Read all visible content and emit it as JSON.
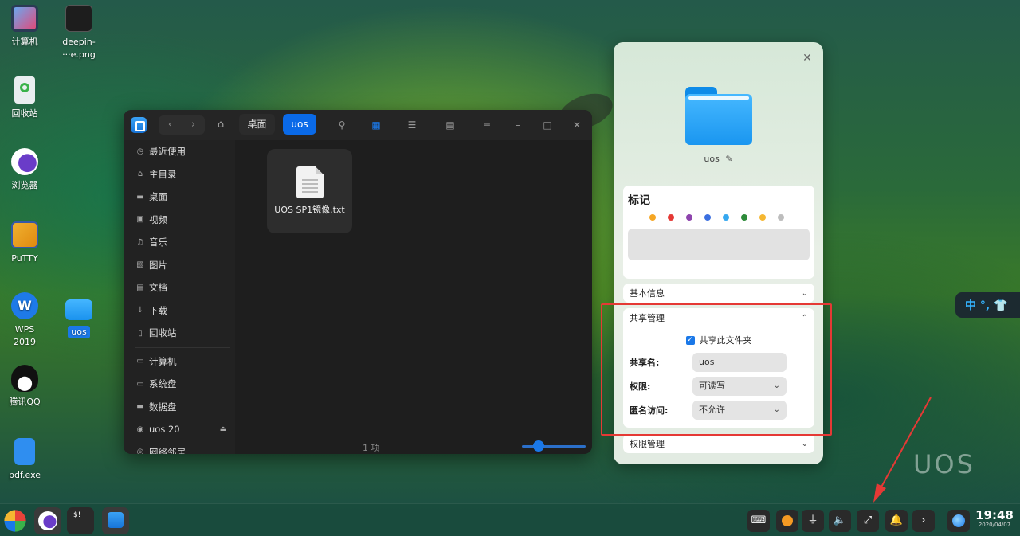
{
  "desktop": {
    "icons": [
      {
        "label": "计算机"
      },
      {
        "label_line1": "deepin-",
        "label_line2": "···e.png"
      },
      {
        "label": "回收站"
      },
      {
        "label": "浏览器"
      },
      {
        "label": "PuTTY"
      },
      {
        "label_line1": "WPS",
        "label_line2": "2019"
      },
      {
        "label": "uos"
      },
      {
        "label": "腾讯QQ"
      },
      {
        "label": "pdf.exe"
      }
    ],
    "watermark": "UOS"
  },
  "file_manager": {
    "breadcrumbs": [
      "桌面",
      "uos"
    ],
    "sidebar": [
      {
        "label": "最近使用",
        "icon": "clock-icon"
      },
      {
        "label": "主目录",
        "icon": "home-icon"
      },
      {
        "label": "桌面",
        "icon": "desktop-icon"
      },
      {
        "label": "视频",
        "icon": "video-icon"
      },
      {
        "label": "音乐",
        "icon": "music-icon"
      },
      {
        "label": "图片",
        "icon": "picture-icon"
      },
      {
        "label": "文档",
        "icon": "document-icon"
      },
      {
        "label": "下载",
        "icon": "download-icon"
      },
      {
        "label": "回收站",
        "icon": "trash-icon"
      },
      {
        "label": "计算机",
        "icon": "computer-icon"
      },
      {
        "label": "系统盘",
        "icon": "disk-icon"
      },
      {
        "label": "数据盘",
        "icon": "disk-icon"
      },
      {
        "label": "uos 20",
        "icon": "disc-icon"
      },
      {
        "label": "网络邻居",
        "icon": "network-icon"
      }
    ],
    "file": {
      "name": "UOS SP1镜像.txt"
    },
    "status": "1 项"
  },
  "properties": {
    "folder_name": "uos",
    "tags_title": "标记",
    "tag_colors": [
      "#f5a623",
      "#e53935",
      "#8e44ad",
      "#3b6fe0",
      "#35a8f0",
      "#2e8b3a",
      "#f5b731",
      "#bdbdbd"
    ],
    "basic_info": "基本信息",
    "share_manage": "共享管理",
    "share_checkbox": "共享此文件夹",
    "share_name_label": "共享名:",
    "share_name_value": "uos",
    "permission_label": "权限:",
    "permission_value": "可读写",
    "anon_label": "匿名访问:",
    "anon_value": "不允许",
    "permission_manage": "权限管理"
  },
  "ime": {
    "text": "中 °, 👕"
  },
  "taskbar": {
    "time": "19:48",
    "date": "2020/04/07"
  }
}
